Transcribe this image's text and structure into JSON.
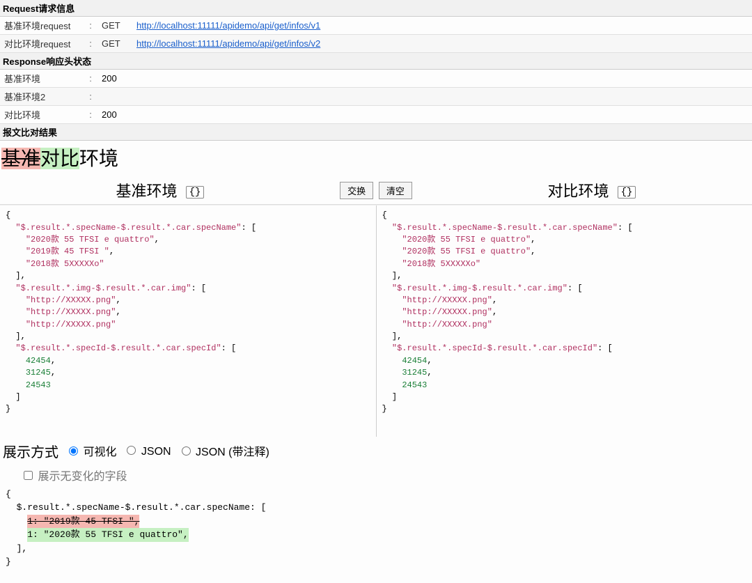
{
  "sections": {
    "request_header": "Request请求信息",
    "response_header": "Response响应头状态",
    "report_header": "报文比对结果"
  },
  "request": {
    "base_label": "基准环境request",
    "compare_label": "对比环境request",
    "sep": ":",
    "method": "GET",
    "base_url": "http://localhost:11111/apidemo/api/get/infos/v1",
    "compare_url": "http://localhost:11111/apidemo/api/get/infos/v2"
  },
  "response": {
    "rows": [
      {
        "label": "基准环境",
        "value": "200"
      },
      {
        "label": "基准环境2",
        "value": ""
      },
      {
        "label": "对比环境",
        "value": "200"
      }
    ],
    "sep": ":"
  },
  "diff_title": {
    "del": "基准",
    "add": "对比",
    "rest": "环境"
  },
  "pane_headers": {
    "left": "基准环境",
    "right": "对比环境"
  },
  "buttons": {
    "swap": "交换",
    "clear": "清空",
    "brace": "{}"
  },
  "json_left": {
    "entries": [
      {
        "key": "$.result.*.specName-$.result.*.car.specName",
        "values_str": [
          "2020款 55 TFSI e quattro",
          "2019款 45 TFSI ",
          "2018款 5XXXXXo"
        ]
      },
      {
        "key": "$.result.*.img-$.result.*.car.img",
        "values_str": [
          "http://XXXXX.png",
          "http://XXXXX.png",
          "http://XXXXX.png"
        ]
      },
      {
        "key": "$.result.*.specId-$.result.*.car.specId",
        "values_num": [
          42454,
          31245,
          24543
        ]
      }
    ]
  },
  "json_right": {
    "entries": [
      {
        "key": "$.result.*.specName-$.result.*.car.specName",
        "values_str": [
          "2020款 55 TFSI e quattro",
          "2020款 55 TFSI e quattro",
          "2018款 5XXXXXo"
        ]
      },
      {
        "key": "$.result.*.img-$.result.*.car.img",
        "values_str": [
          "http://XXXXX.png",
          "http://XXXXX.png",
          "http://XXXXX.png"
        ]
      },
      {
        "key": "$.result.*.specId-$.result.*.car.specId",
        "values_num": [
          42454,
          31245,
          24543
        ]
      }
    ]
  },
  "display_mode": {
    "label": "展示方式",
    "options": {
      "visual": "可视化",
      "json": "JSON",
      "json_annot": "JSON (带注释)"
    },
    "selected": "visual",
    "show_unchanged_label": "展示无变化的字段",
    "show_unchanged_checked": false
  },
  "diff_result": {
    "open": "{",
    "path": "$.result.*.specName-$.result.*.car.specName: [",
    "del_line": "1: \"2019款 45 TFSI \",",
    "add_line": "1: \"2020款 55 TFSI e quattro\",",
    "close_arr": "],",
    "close": "}"
  }
}
